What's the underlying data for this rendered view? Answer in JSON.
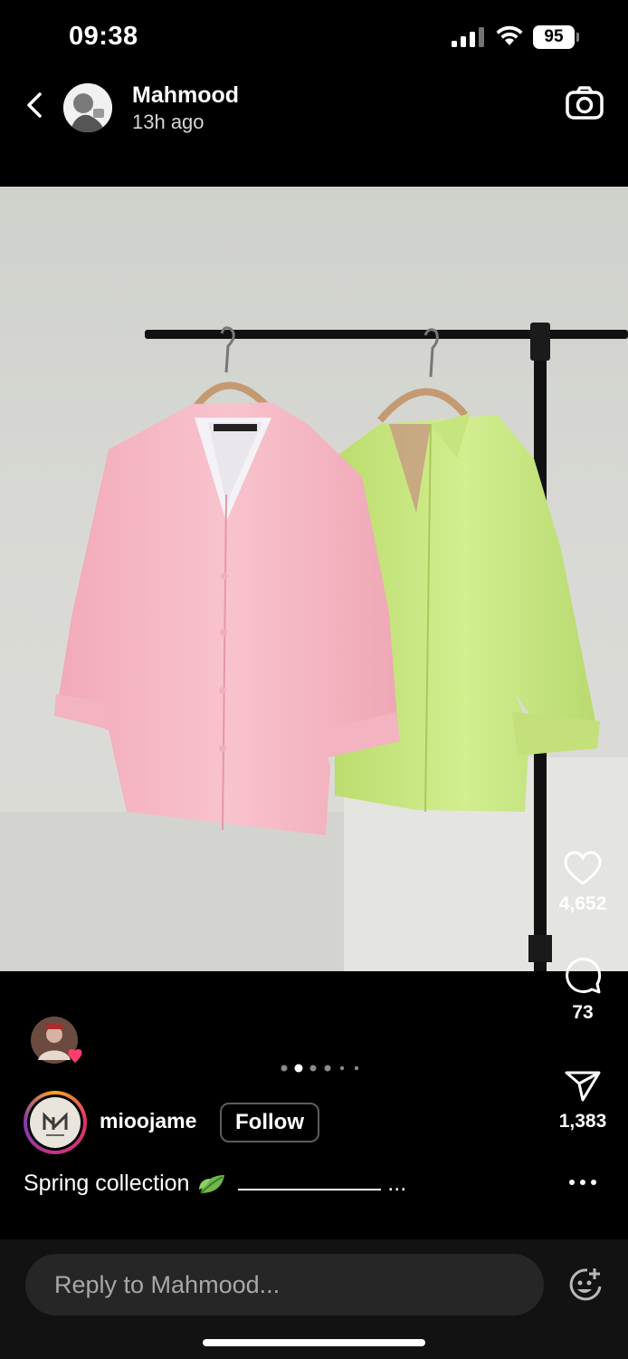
{
  "status_bar": {
    "time": "09:38",
    "battery": "95"
  },
  "header": {
    "username": "Mahmood",
    "timestamp": "13h ago"
  },
  "actions": {
    "likes": "4,652",
    "comments": "73",
    "shares": "1,383"
  },
  "pagination": {
    "total": 6,
    "active_index": 1
  },
  "account": {
    "name": "mioojame",
    "follow_label": "Follow"
  },
  "caption": {
    "text": "Spring collection",
    "ellipsis": "..."
  },
  "reply": {
    "placeholder": "Reply to Mahmood..."
  },
  "icons": {
    "back": "back-icon",
    "camera": "camera-icon",
    "like": "heart-icon",
    "comment": "comment-icon",
    "share": "send-icon",
    "more": "more-icon",
    "sticker": "sticker-icon"
  },
  "colors": {
    "background": "#000000",
    "reply_bar": "#121212",
    "reply_input": "#262626",
    "pink_shirt": "#f5b8c4",
    "green_shirt": "#c9e887",
    "wall": "#d6d7d3"
  }
}
